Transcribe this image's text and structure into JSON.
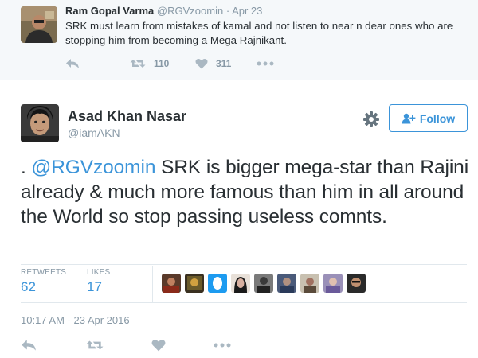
{
  "parent_tweet": {
    "author_name": "Ram Gopal Varma",
    "handle": "@RGVzoomin",
    "separator": "·",
    "date": "Apr 23",
    "text": "SRK must learn from mistakes of kamal and not listen to near n dear ones who are stopping him from becoming a Mega Rajnikant.",
    "actions": {
      "reply_icon": "reply-icon",
      "retweet_icon": "retweet-icon",
      "retweet_count": "110",
      "like_icon": "heart-icon",
      "like_count": "311",
      "more_icon": "more-icon"
    }
  },
  "main_tweet": {
    "author_name": "Asad Khan Nasar",
    "handle": "@iamAKN",
    "follow_label": "Follow",
    "text_prefix": ". ",
    "mention": "@RGVzoomin",
    "text_body": " SRK is bigger mega-star than Rajini already & much more famous than him in all around the World so stop passing useless comnts.",
    "stats": {
      "retweets_label": "RETWEETS",
      "retweets_value": "62",
      "likes_label": "LIKES",
      "likes_value": "17"
    },
    "timestamp": "10:17 AM - 23 Apr 2016"
  },
  "colors": {
    "accent": "#3b94d9",
    "muted": "#8899a6",
    "text": "#292f33",
    "parent_bg": "#f5f8fa",
    "border": "#e1e8ed"
  }
}
